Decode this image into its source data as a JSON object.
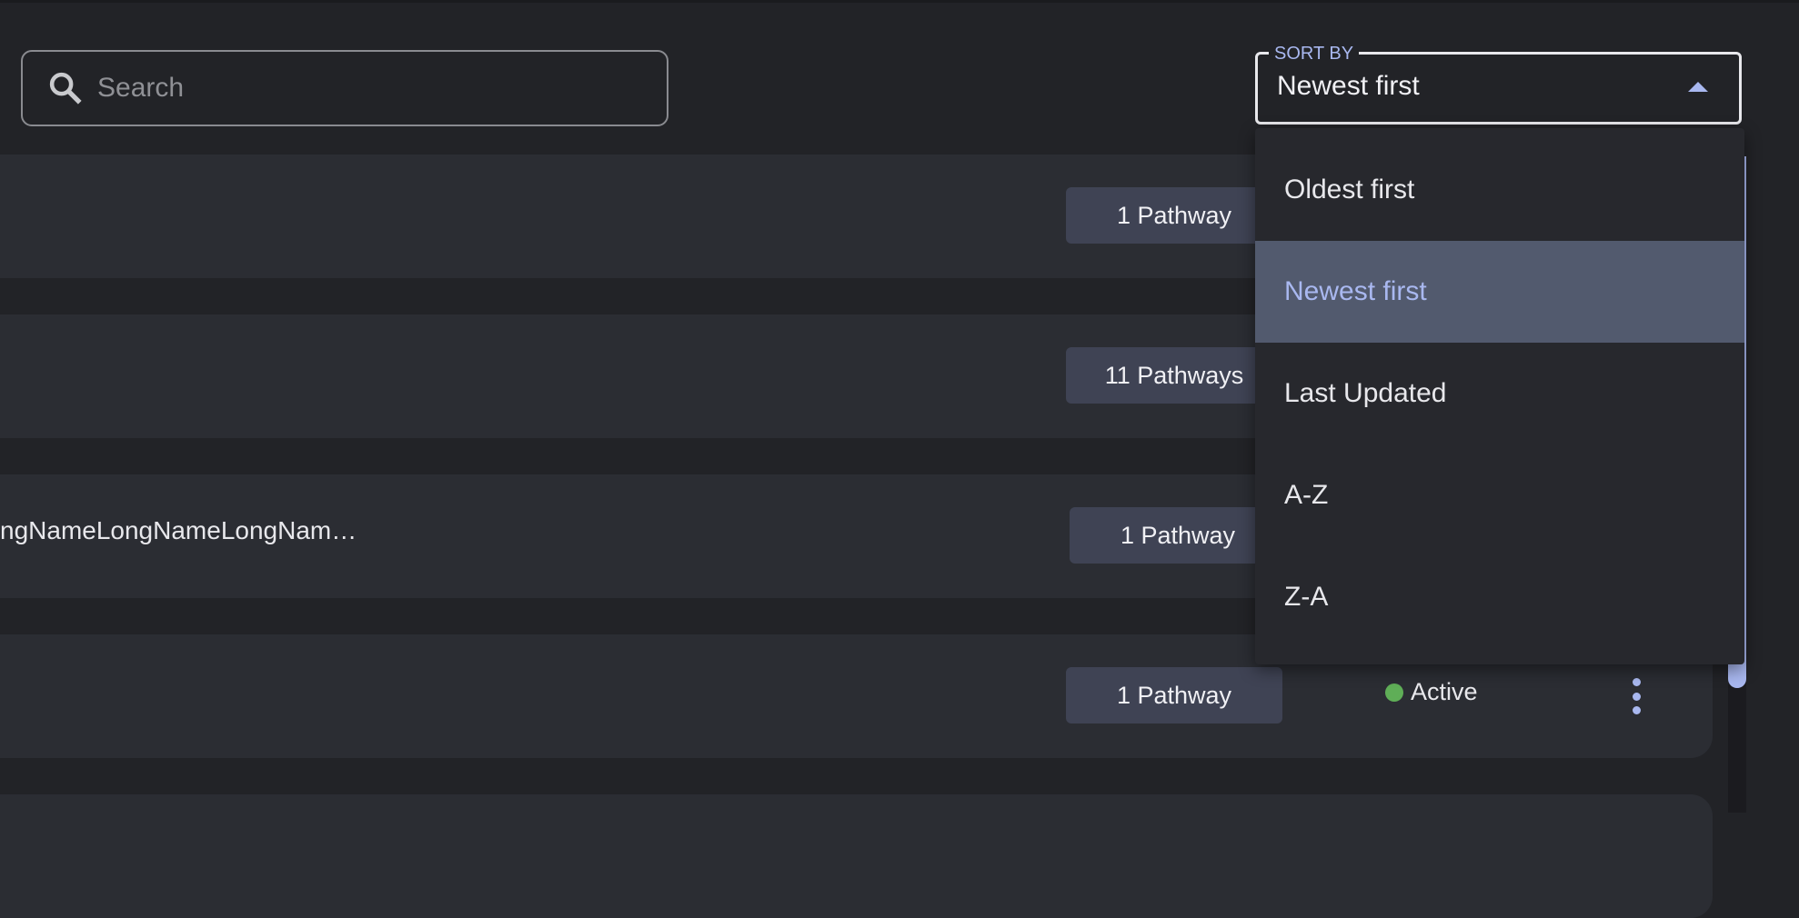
{
  "search": {
    "placeholder": "Search",
    "value": "",
    "icon": "search-icon"
  },
  "sort": {
    "label": "SORT BY",
    "selected": "Newest first",
    "options": [
      "Oldest first",
      "Newest first",
      "Last Updated",
      "A-Z",
      "Z-A"
    ],
    "selected_index": 1
  },
  "rows": [
    {
      "name": "",
      "pathways": "1 Pathway"
    },
    {
      "name": "",
      "pathways": "11 Pathways"
    },
    {
      "name": "ngNameLongNameLongNam…",
      "pathways": "1 Pathway"
    },
    {
      "name": "",
      "pathways": "1 Pathway",
      "status": "Active"
    }
  ],
  "colors": {
    "accent": "#a9b8f0",
    "active": "#5fae57",
    "background": "#222327",
    "row": "#2b2d33",
    "badge": "#3f4354",
    "selected_option": "#525a6e"
  }
}
